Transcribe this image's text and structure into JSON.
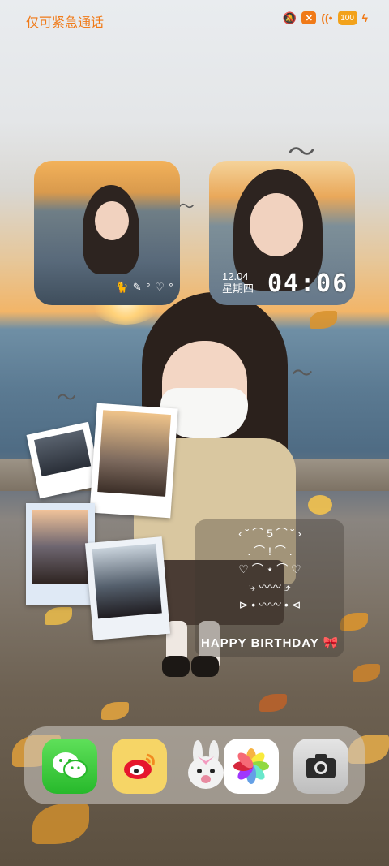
{
  "status_bar": {
    "carrier": "仅可紧急通话",
    "battery": "100",
    "icons": [
      "mute-icon",
      "no-sim-icon",
      "wifi-icon",
      "battery-icon",
      "charging-icon"
    ]
  },
  "widgets": {
    "clock": {
      "date": "12.04",
      "weekday": "星期四",
      "time": "04:06"
    },
    "photo_deco": "🐈 ✎ ° ♡ °"
  },
  "birthday_widget": {
    "art": "‹ ˘ ⌒ 5 ⌒ ˘ ›\n. ⌒ ! ⌒ .\n♡ ⌒ ⋆ ⌒ ♡\n⤷ 〰〰 ⤴\n⊳ • 〰〰 • ⊲",
    "text": "HAPPY BIRTHDAY",
    "emoji": "🎀"
  },
  "dock": {
    "apps": [
      {
        "name": "WeChat",
        "icon": "wechat-icon"
      },
      {
        "name": "Weibo",
        "icon": "weibo-icon"
      },
      {
        "name": "Bunny",
        "icon": "bunny-sticker-icon"
      },
      {
        "name": "Photos",
        "icon": "photos-icon"
      },
      {
        "name": "Camera",
        "icon": "camera-icon"
      }
    ]
  },
  "colors": {
    "status_accent": "#f07a18",
    "battery": "#f2a21b",
    "dock_bg": "#d2cdc8"
  }
}
